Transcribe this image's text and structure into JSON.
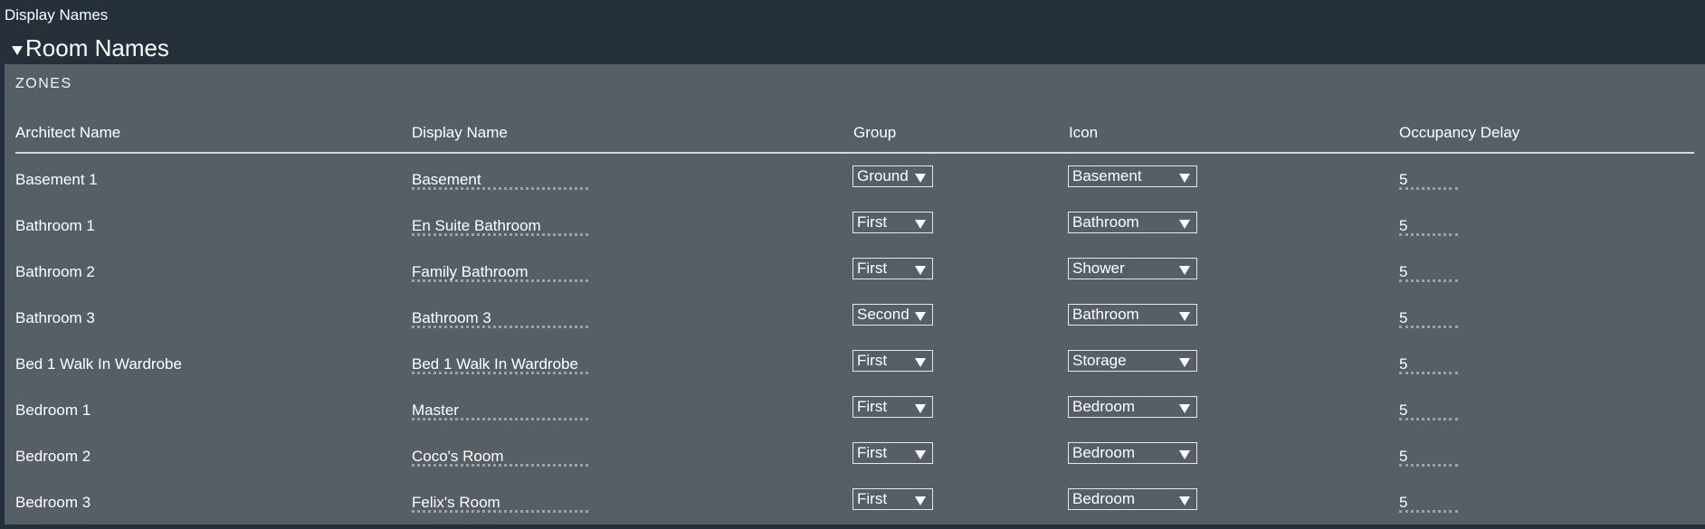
{
  "app": {
    "title": "Display Names"
  },
  "section": {
    "title": "Room Names"
  },
  "zones": {
    "title": "ZONES",
    "columns": [
      "Architect Name",
      "Display Name",
      "Group",
      "Icon",
      "Occupancy Delay"
    ],
    "rows": [
      {
        "architect": "Basement 1",
        "display": "Basement",
        "group": "Ground",
        "icon": "Basement",
        "delay": "5"
      },
      {
        "architect": "Bathroom 1",
        "display": "En Suite Bathroom",
        "group": "First",
        "icon": "Bathroom",
        "delay": "5"
      },
      {
        "architect": "Bathroom 2",
        "display": "Family Bathroom",
        "group": "First",
        "icon": "Shower",
        "delay": "5"
      },
      {
        "architect": "Bathroom 3",
        "display": "Bathroom 3",
        "group": "Second",
        "icon": "Bathroom",
        "delay": "5"
      },
      {
        "architect": "Bed 1 Walk In Wardrobe",
        "display": "Bed 1 Walk In Wardrobe",
        "group": "First",
        "icon": "Storage",
        "delay": "5"
      },
      {
        "architect": "Bedroom 1",
        "display": "Master",
        "group": "First",
        "icon": "Bedroom",
        "delay": "5"
      },
      {
        "architect": "Bedroom 2",
        "display": "Coco's Room",
        "group": "First",
        "icon": "Bedroom",
        "delay": "5"
      },
      {
        "architect": "Bedroom 3",
        "display": "Felix's Room",
        "group": "First",
        "icon": "Bedroom",
        "delay": "5"
      }
    ]
  },
  "colors": {
    "header_bg": "#25303b",
    "panel_bg": "#565e66",
    "text": "#ffffff"
  },
  "icons": {
    "collapse": "triangle-down-icon",
    "select_arrow": "triangle-down-icon"
  }
}
